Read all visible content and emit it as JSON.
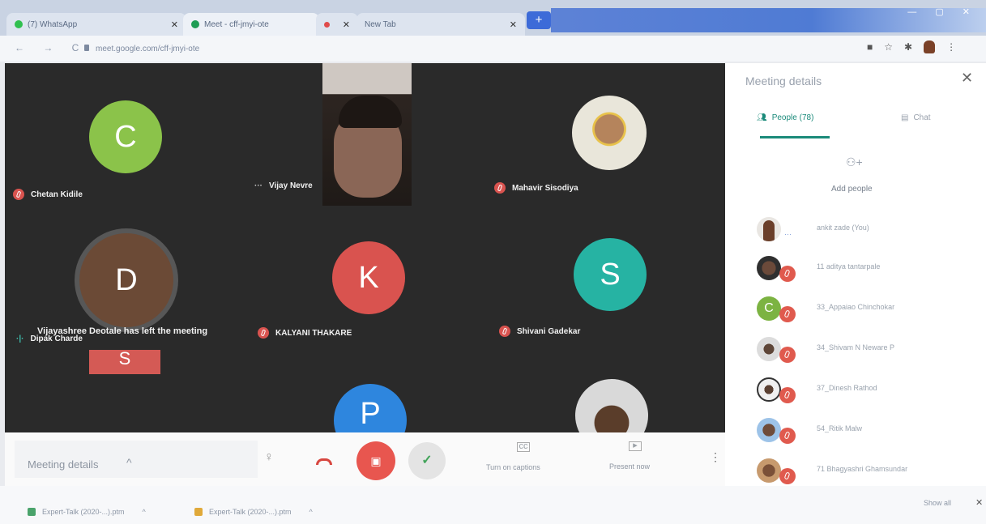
{
  "browser": {
    "tabs": [
      {
        "label": "(7) WhatsApp"
      },
      {
        "label": "Meet - cff-jmyi-ote"
      },
      {
        "label": ""
      },
      {
        "label": "New Tab"
      }
    ],
    "new_tab_label": "+",
    "url": "meet.google.com/cff-jmyi-ote"
  },
  "grid": {
    "tiles": [
      {
        "name": "Chetan Kidile",
        "initial": "C",
        "color": "#8bc34a"
      },
      {
        "name": "Vijay Nevre",
        "initial": "",
        "color": ""
      },
      {
        "name": "Mahavir Sisodiya",
        "initial": "",
        "color": ""
      },
      {
        "name": "Dipak Charde",
        "initial": "D",
        "color": "#7b4a33"
      },
      {
        "name": "KALYANI THAKARE",
        "initial": "K",
        "color": "#d9534f"
      },
      {
        "name": "Shivani Gadekar",
        "initial": "S",
        "color": "#26b3a3"
      },
      {
        "name": "",
        "initial": "S",
        "color": "#d45a55"
      },
      {
        "name": "",
        "initial": "P",
        "color": "#2e86de"
      },
      {
        "name": "",
        "initial": "",
        "color": ""
      }
    ],
    "toast": "Vijayashree Deotale has left the meeting"
  },
  "controls": {
    "meeting_details_label": "Meeting details",
    "captions_label": "Turn on captions",
    "present_label": "Present now"
  },
  "side_panel": {
    "title": "Meeting details",
    "people_tab": "People (78)",
    "chat_tab": "Chat",
    "add_people": "Add people",
    "participants": [
      {
        "name": "ankit zade (You)"
      },
      {
        "name": "11 aditya tantarpale"
      },
      {
        "name": "33_Appaiao Chinchokar"
      },
      {
        "name": "34_Shivam N Neware P"
      },
      {
        "name": "37_Dinesh Rathod"
      },
      {
        "name": "54_Ritik Malw"
      },
      {
        "name": "71 Bhagyashri Ghamsundar"
      }
    ]
  },
  "downloads": {
    "items": [
      {
        "label": "Expert-Talk (2020-...).ptm"
      },
      {
        "label": "Expert-Talk (2020-...).ptm"
      }
    ],
    "show_all": "Show all"
  },
  "colors": {
    "accent": "#1a8a7a",
    "hangup_red": "#e8564f"
  }
}
